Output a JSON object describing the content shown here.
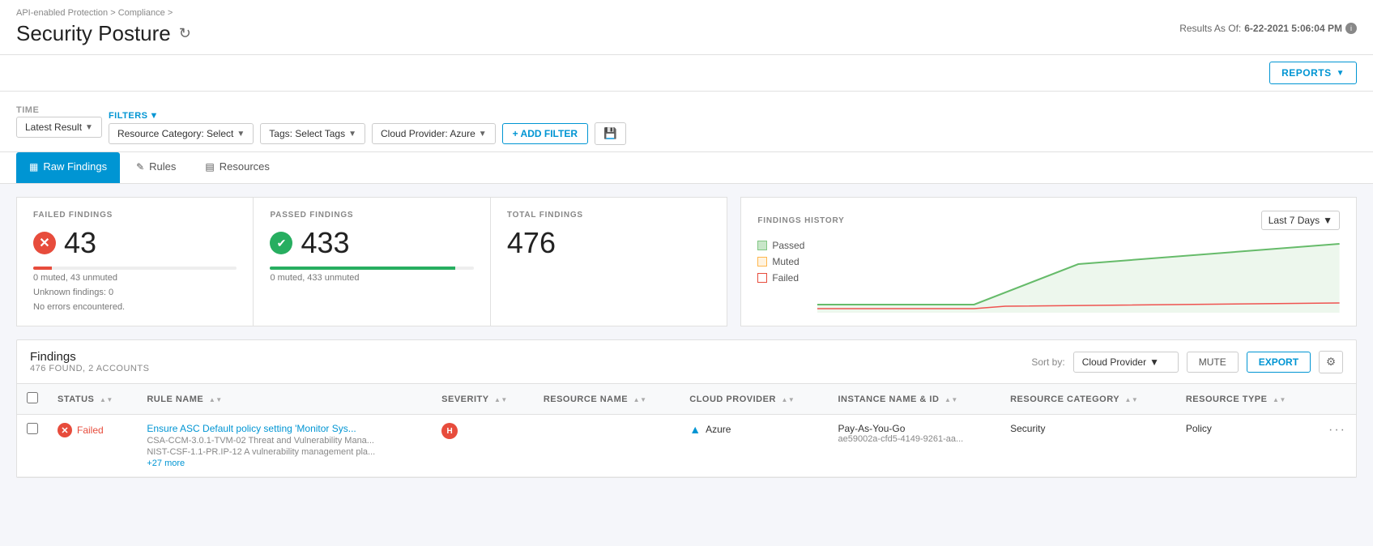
{
  "breadcrumb": {
    "items": [
      "API-enabled Protection",
      "Compliance",
      ""
    ]
  },
  "page": {
    "title": "Security Posture",
    "results_as_of": "Results As Of:",
    "results_date": "6-22-2021 5:06:04 PM"
  },
  "toolbar": {
    "reports_label": "REPORTS"
  },
  "filters": {
    "time_label": "TIME",
    "filters_label": "FILTERS",
    "latest_result": "Latest Result",
    "resource_category": "Resource Category: Select",
    "tags": "Tags: Select Tags",
    "cloud_provider": "Cloud Provider: Azure",
    "add_filter": "+ ADD FILTER"
  },
  "tabs": {
    "raw_findings": "Raw Findings",
    "rules": "Rules",
    "resources": "Resources"
  },
  "stats": {
    "failed": {
      "label": "FAILED FINDINGS",
      "value": "43",
      "sub": "0 muted, 43 unmuted",
      "bar_pct": 9,
      "unknown": "Unknown findings: 0",
      "no_errors": "No errors encountered."
    },
    "passed": {
      "label": "PASSED FINDINGS",
      "value": "433",
      "sub": "0 muted, 433 unmuted",
      "bar_pct": 91
    },
    "total": {
      "label": "TOTAL FINDINGS",
      "value": "476"
    }
  },
  "history": {
    "title": "FINDINGS HISTORY",
    "dropdown": "Last 7 Days",
    "legend": {
      "passed": "Passed",
      "muted": "Muted",
      "failed": "Failed"
    }
  },
  "findings": {
    "title": "Findings",
    "count": "476 FOUND, 2 ACCOUNTS",
    "sort_by_label": "Sort by:",
    "sort_by_value": "Cloud Provider",
    "mute_label": "MUTE",
    "export_label": "EXPORT",
    "columns": {
      "status": "STATUS",
      "rule_name": "RULE NAME",
      "severity": "SEVERITY",
      "resource_name": "RESOURCE NAME",
      "cloud_provider": "CLOUD PROVIDER",
      "instance_name": "INSTANCE NAME & ID",
      "resource_category": "RESOURCE CATEGORY",
      "resource_type": "RESOURCE TYPE"
    },
    "rows": [
      {
        "status": "Failed",
        "rule_name": "Ensure ASC Default policy setting 'Monitor Sys...",
        "rule_sub1": "CSA-CCM-3.0.1-TVM-02 Threat and Vulnerability Mana...",
        "rule_sub2": "NIST-CSF-1.1-PR.IP-12 A vulnerability management pla...",
        "rule_sub3": "+27 more",
        "severity": "H",
        "resource_name": "",
        "cloud_provider": "Azure",
        "instance_name": "Pay-As-You-Go",
        "instance_id": "ae59002a-cfd5-4149-9261-aa...",
        "resource_category": "Security",
        "resource_type": "Policy"
      }
    ]
  }
}
